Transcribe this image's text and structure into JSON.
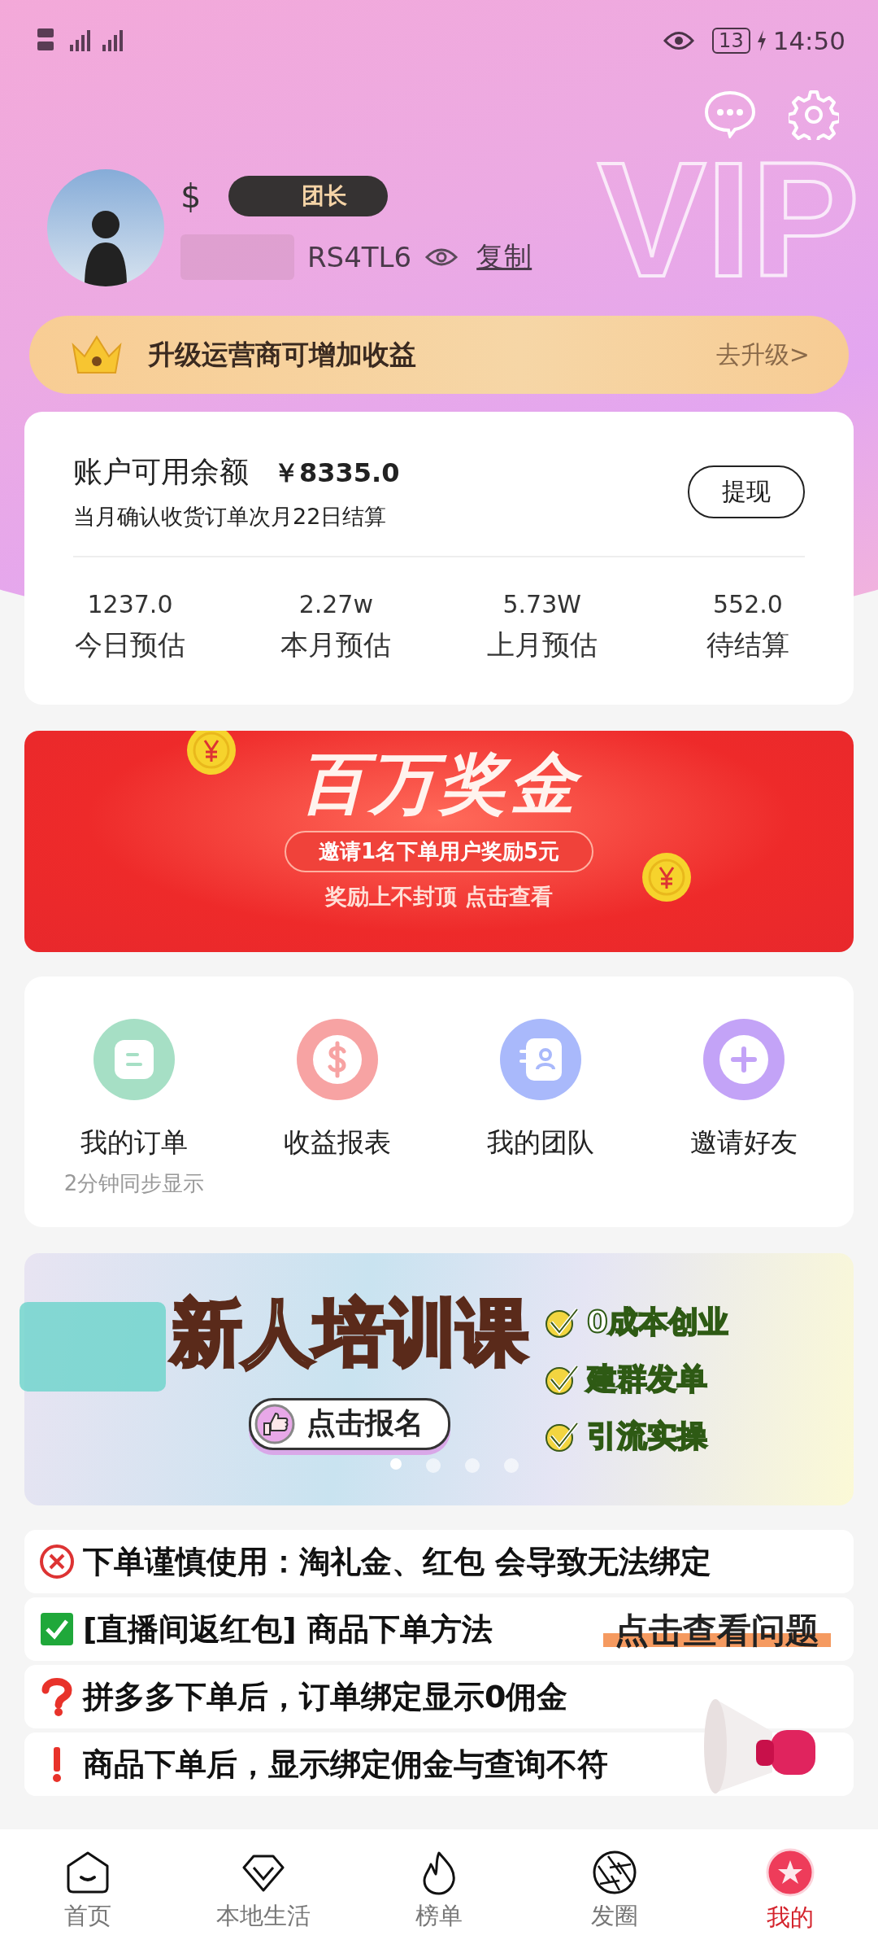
{
  "status_bar": {
    "time": "14:50",
    "battery": "13"
  },
  "background_mark": "VIP",
  "profile": {
    "currency_symbol": "$",
    "badge": "团长",
    "invite_code": "RS4TL6",
    "copy_link": "复制"
  },
  "upgrade_bar": {
    "text": "升级运营商可增加收益",
    "action": "去升级>"
  },
  "balance_card": {
    "title": "账户可用余额",
    "amount": "￥8335.0",
    "note": "当月确认收货订单次月22日结算",
    "withdraw_button": "提现",
    "stats": [
      {
        "value": "1237.0",
        "label": "今日预估"
      },
      {
        "value": "2.27w",
        "label": "本月预估"
      },
      {
        "value": "5.73W",
        "label": "上月预估"
      },
      {
        "value": "552.0",
        "label": "待结算"
      }
    ]
  },
  "promo_banner": {
    "headline": "百万奖金",
    "pill": "邀请1名下单用户奖励5元",
    "subline": "奖励上不封顶 点击查看"
  },
  "menu": [
    {
      "kind": "orders",
      "label": "我的订单",
      "note": "2分钟同步显示",
      "color": "#a6dfc5"
    },
    {
      "kind": "income",
      "label": "收益报表",
      "color": "#f7a3a3"
    },
    {
      "kind": "team",
      "label": "我的团队",
      "color": "#a9b9fb"
    },
    {
      "kind": "invite",
      "label": "邀请好友",
      "color": "#c3a3f7"
    }
  ],
  "training_banner": {
    "headline": "新人培训课",
    "button": "点击报名",
    "points": [
      "0成本创业",
      "建群发单",
      "引流实操"
    ],
    "dots": [
      {
        "selected": true
      },
      {
        "selected": false
      },
      {
        "selected": false
      },
      {
        "selected": false
      }
    ]
  },
  "notices": [
    {
      "kind": "warning",
      "text": "下单谨慎使用：淘礼金、红包 会导致无法绑定"
    },
    {
      "kind": "check",
      "text": "[直播间返红包] 商品下单方法"
    },
    {
      "kind": "question",
      "text": "拼多多下单后，订单绑定显示0佣金"
    },
    {
      "kind": "alert",
      "text": "商品下单后，显示绑定佣金与查询不符"
    }
  ],
  "notice_overlay": "点击查看问题",
  "tab_bar": [
    {
      "kind": "home",
      "label": "首页",
      "selected": false
    },
    {
      "kind": "local",
      "label": "本地生活",
      "selected": false
    },
    {
      "kind": "rank",
      "label": "榜单",
      "selected": false
    },
    {
      "kind": "moments",
      "label": "发圈",
      "selected": false
    },
    {
      "kind": "mine",
      "label": "我的",
      "selected": true
    }
  ]
}
